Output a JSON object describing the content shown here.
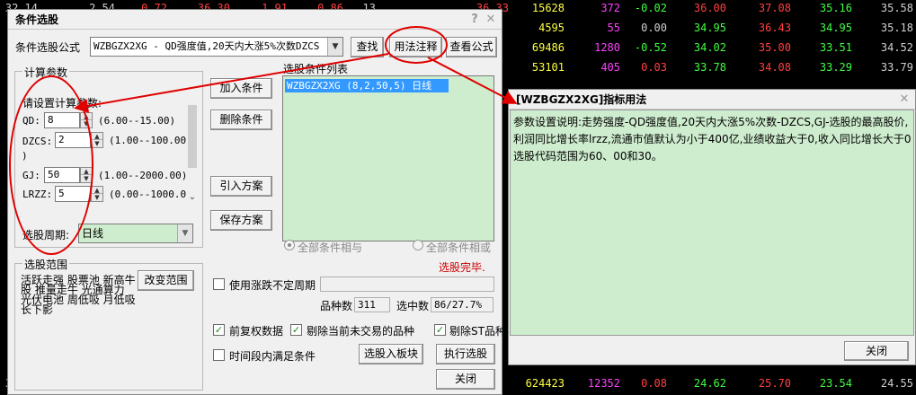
{
  "background_rows": [
    {
      "cells": [
        "32.14",
        "2.54",
        "0.72",
        "36.30",
        "1.91",
        "0.86",
        "13",
        "36.33",
        "15628",
        "372",
        "-0.02",
        "36.00",
        "37.08",
        "35.16",
        "35.58"
      ],
      "colors": [
        "#d0d0d0",
        "#d0d0d0",
        "#ff4040",
        "#ff4040",
        "#ff4040",
        "#ff4040",
        "#d0d0d0",
        "#ff4040",
        "#ffff40",
        "#ff40ff",
        "#40ff40",
        "#ff4040",
        "#ff4040",
        "#40ff40",
        "#d0d0d0"
      ]
    },
    {
      "cells": [
        "",
        "",
        "",
        "",
        "",
        "",
        "",
        "",
        "4595",
        "55",
        "0.00",
        "34.95",
        "36.43",
        "34.95",
        "35.18"
      ],
      "colors": [
        "",
        "",
        "",
        "",
        "",
        "",
        "",
        "",
        "#ffff40",
        "#ff40ff",
        "#d0d0d0",
        "#40ff40",
        "#ff4040",
        "#40ff40",
        "#d0d0d0"
      ]
    },
    {
      "cells": [
        "",
        "",
        "",
        "",
        "",
        "",
        "",
        "",
        "69486",
        "1280",
        "-0.52",
        "34.02",
        "35.00",
        "33.51",
        "34.52"
      ],
      "colors": [
        "",
        "",
        "",
        "",
        "",
        "",
        "",
        "",
        "#ffff40",
        "#ff40ff",
        "#40ff40",
        "#40ff40",
        "#ff4040",
        "#40ff40",
        "#d0d0d0"
      ]
    },
    {
      "cells": [
        "",
        "",
        "",
        "",
        "",
        "",
        "",
        "",
        "53101",
        "405",
        "0.03",
        "33.78",
        "34.08",
        "33.29",
        "33.79"
      ],
      "colors": [
        "",
        "",
        "",
        "",
        "",
        "",
        "",
        "",
        "#ffff40",
        "#ff40ff",
        "#ff4040",
        "#40ff40",
        "#ff4040",
        "#40ff40",
        "#d0d0d0"
      ]
    },
    {
      "cells": [
        "32.25",
        "",
        "",
        "",
        "",
        "",
        "",
        "",
        "624423",
        "12352",
        "0.08",
        "24.62",
        "25.70",
        "23.54",
        "24.55"
      ],
      "colors": [
        "#d0d0d0",
        "",
        "",
        "",
        "",
        "",
        "",
        "",
        "#ffff40",
        "#ff40ff",
        "#ff4040",
        "#40ff40",
        "#ff4040",
        "#40ff40",
        "#d0d0d0"
      ]
    }
  ],
  "dialog1": {
    "title": "条件选股",
    "formula_label": "条件选股公式",
    "formula_value": "WZBGZX2XG    - QD强度值,20天内大涨5%次数DZCS",
    "btn_find": "查找",
    "btn_usage": "用法注释",
    "btn_view": "查看公式",
    "params_legend": "计算参数",
    "params_prompt": "请设置计算参数:",
    "params": [
      {
        "name": "QD:",
        "value": "8",
        "range": "(6.00--15.00)"
      },
      {
        "name": "DZCS:",
        "value": "2",
        "range": "(1.00--100.00"
      },
      {
        "name": "GJ:",
        "value": "50",
        "range": "(1.00--2000.00)"
      },
      {
        "name": "LRZZ:",
        "value": "5",
        "range": "(0.00--1000.0"
      }
    ],
    "param_wrap": ")",
    "period_label": "选股周期:",
    "period_value": "日线",
    "list_label": "选股条件列表",
    "list_items": [
      "WZBGZX2XG (8,2,50,5) 日线"
    ],
    "btn_add": "加入条件",
    "btn_delete": "删除条件",
    "btn_import": "引入方案",
    "btn_save": "保存方案",
    "radio_and": "全部条件相与",
    "radio_or": "全部条件相或",
    "status": "选股完毕.",
    "range_legend": "选股范围",
    "range_text": "活跃走强 股票池 新高牛股 推量走牛 光通算力 光伏电池 周低吸 月低吸 长下影",
    "btn_range": "改变范围",
    "opt_variable": "使用涨跌不定周期",
    "count_label": "品种数",
    "count_value": "311",
    "selected_label": "选中数",
    "selected_value": "86/27.7%",
    "opt_prefq": "前复权数据",
    "opt_exclude_untraded": "剔除当前未交易的品种",
    "opt_exclude_st": "剔除ST品种",
    "opt_time_period": "时间段内满足条件",
    "btn_to_board": "选股入板块",
    "btn_execute": "执行选股",
    "btn_close": "关闭"
  },
  "dialog2": {
    "title": "[WZBGZX2XG]指标用法",
    "content": "参数设置说明:走势强度-QD强度值,20天内大涨5%次数-DZCS,GJ-选股的最高股价,利润同比增长率lrzz,流通市值默认为小于400亿,业绩收益大于0,收入同比增长大于0选股代码范围为60、00和30。",
    "btn_close": "关闭"
  },
  "colors": {
    "annotation": "#e00000",
    "list_bg": "#ceecce",
    "list_selected": "#3399ff",
    "status": "#cc0000"
  }
}
